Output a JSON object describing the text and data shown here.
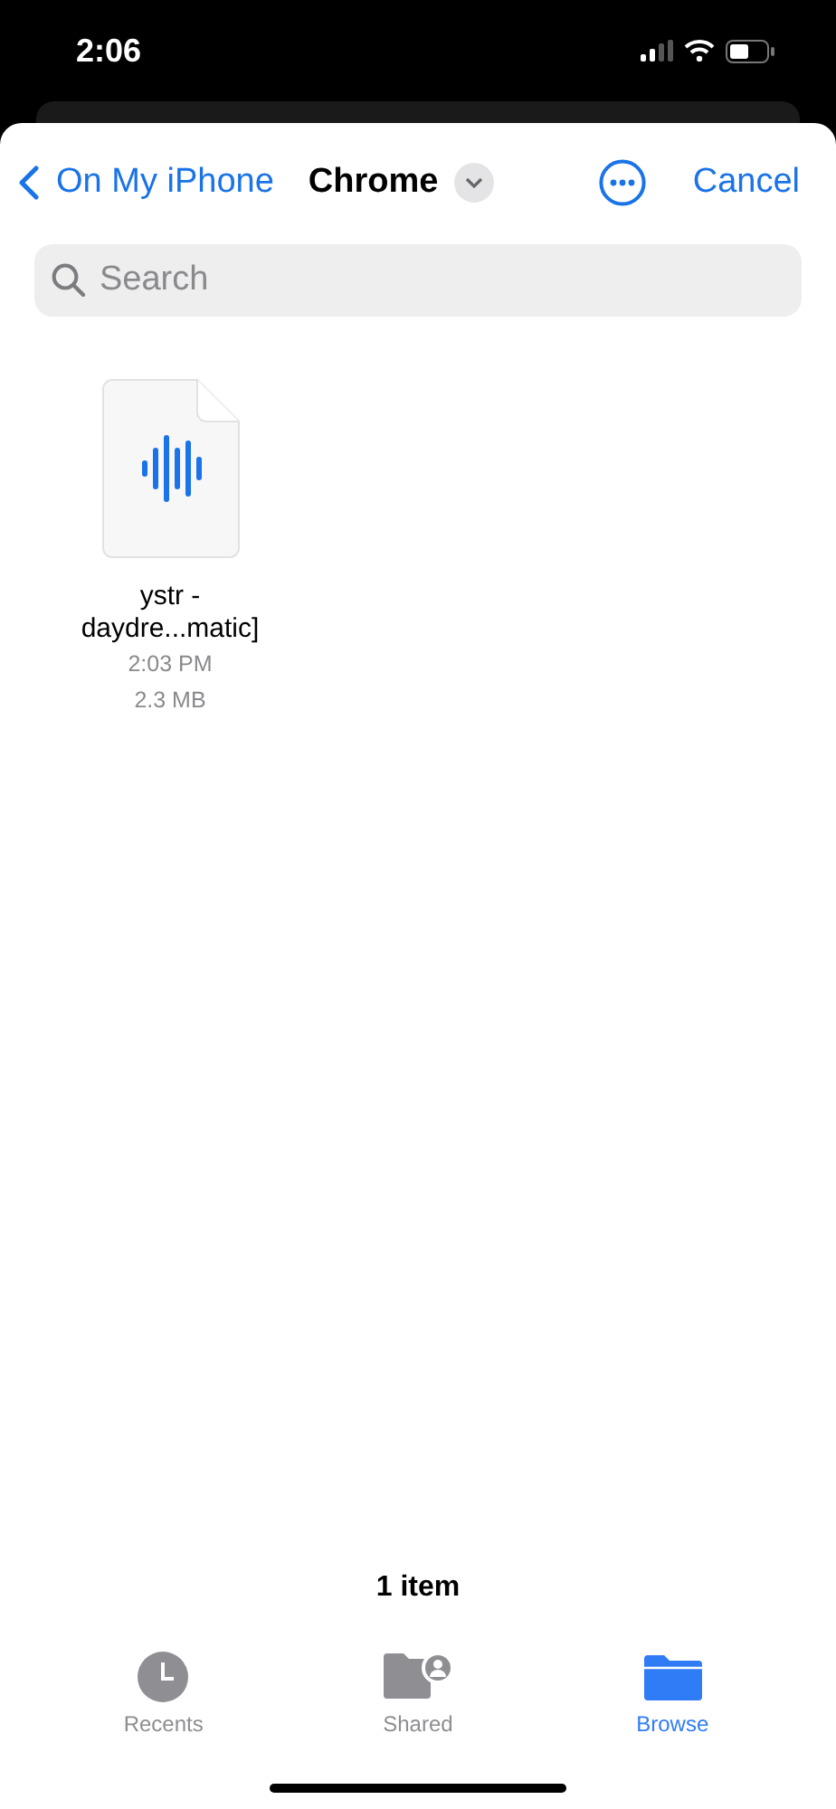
{
  "status_bar": {
    "time": "2:06"
  },
  "nav": {
    "back": "On My iPhone",
    "title": "Chrome",
    "action": "Cancel"
  },
  "search": {
    "placeholder": "Search"
  },
  "files": [
    {
      "kind": "audio",
      "name_lines": [
        "ystr -",
        "daydre...matic]"
      ],
      "time": "2:03 PM",
      "size": "2.3 MB"
    }
  ],
  "footer": {
    "count": "1 item"
  },
  "tabs": [
    {
      "kind": "recents",
      "label": "Recents",
      "selected": false
    },
    {
      "kind": "shared",
      "label": "Shared",
      "selected": false
    },
    {
      "kind": "browse",
      "label": "Browse",
      "selected": true
    }
  ]
}
